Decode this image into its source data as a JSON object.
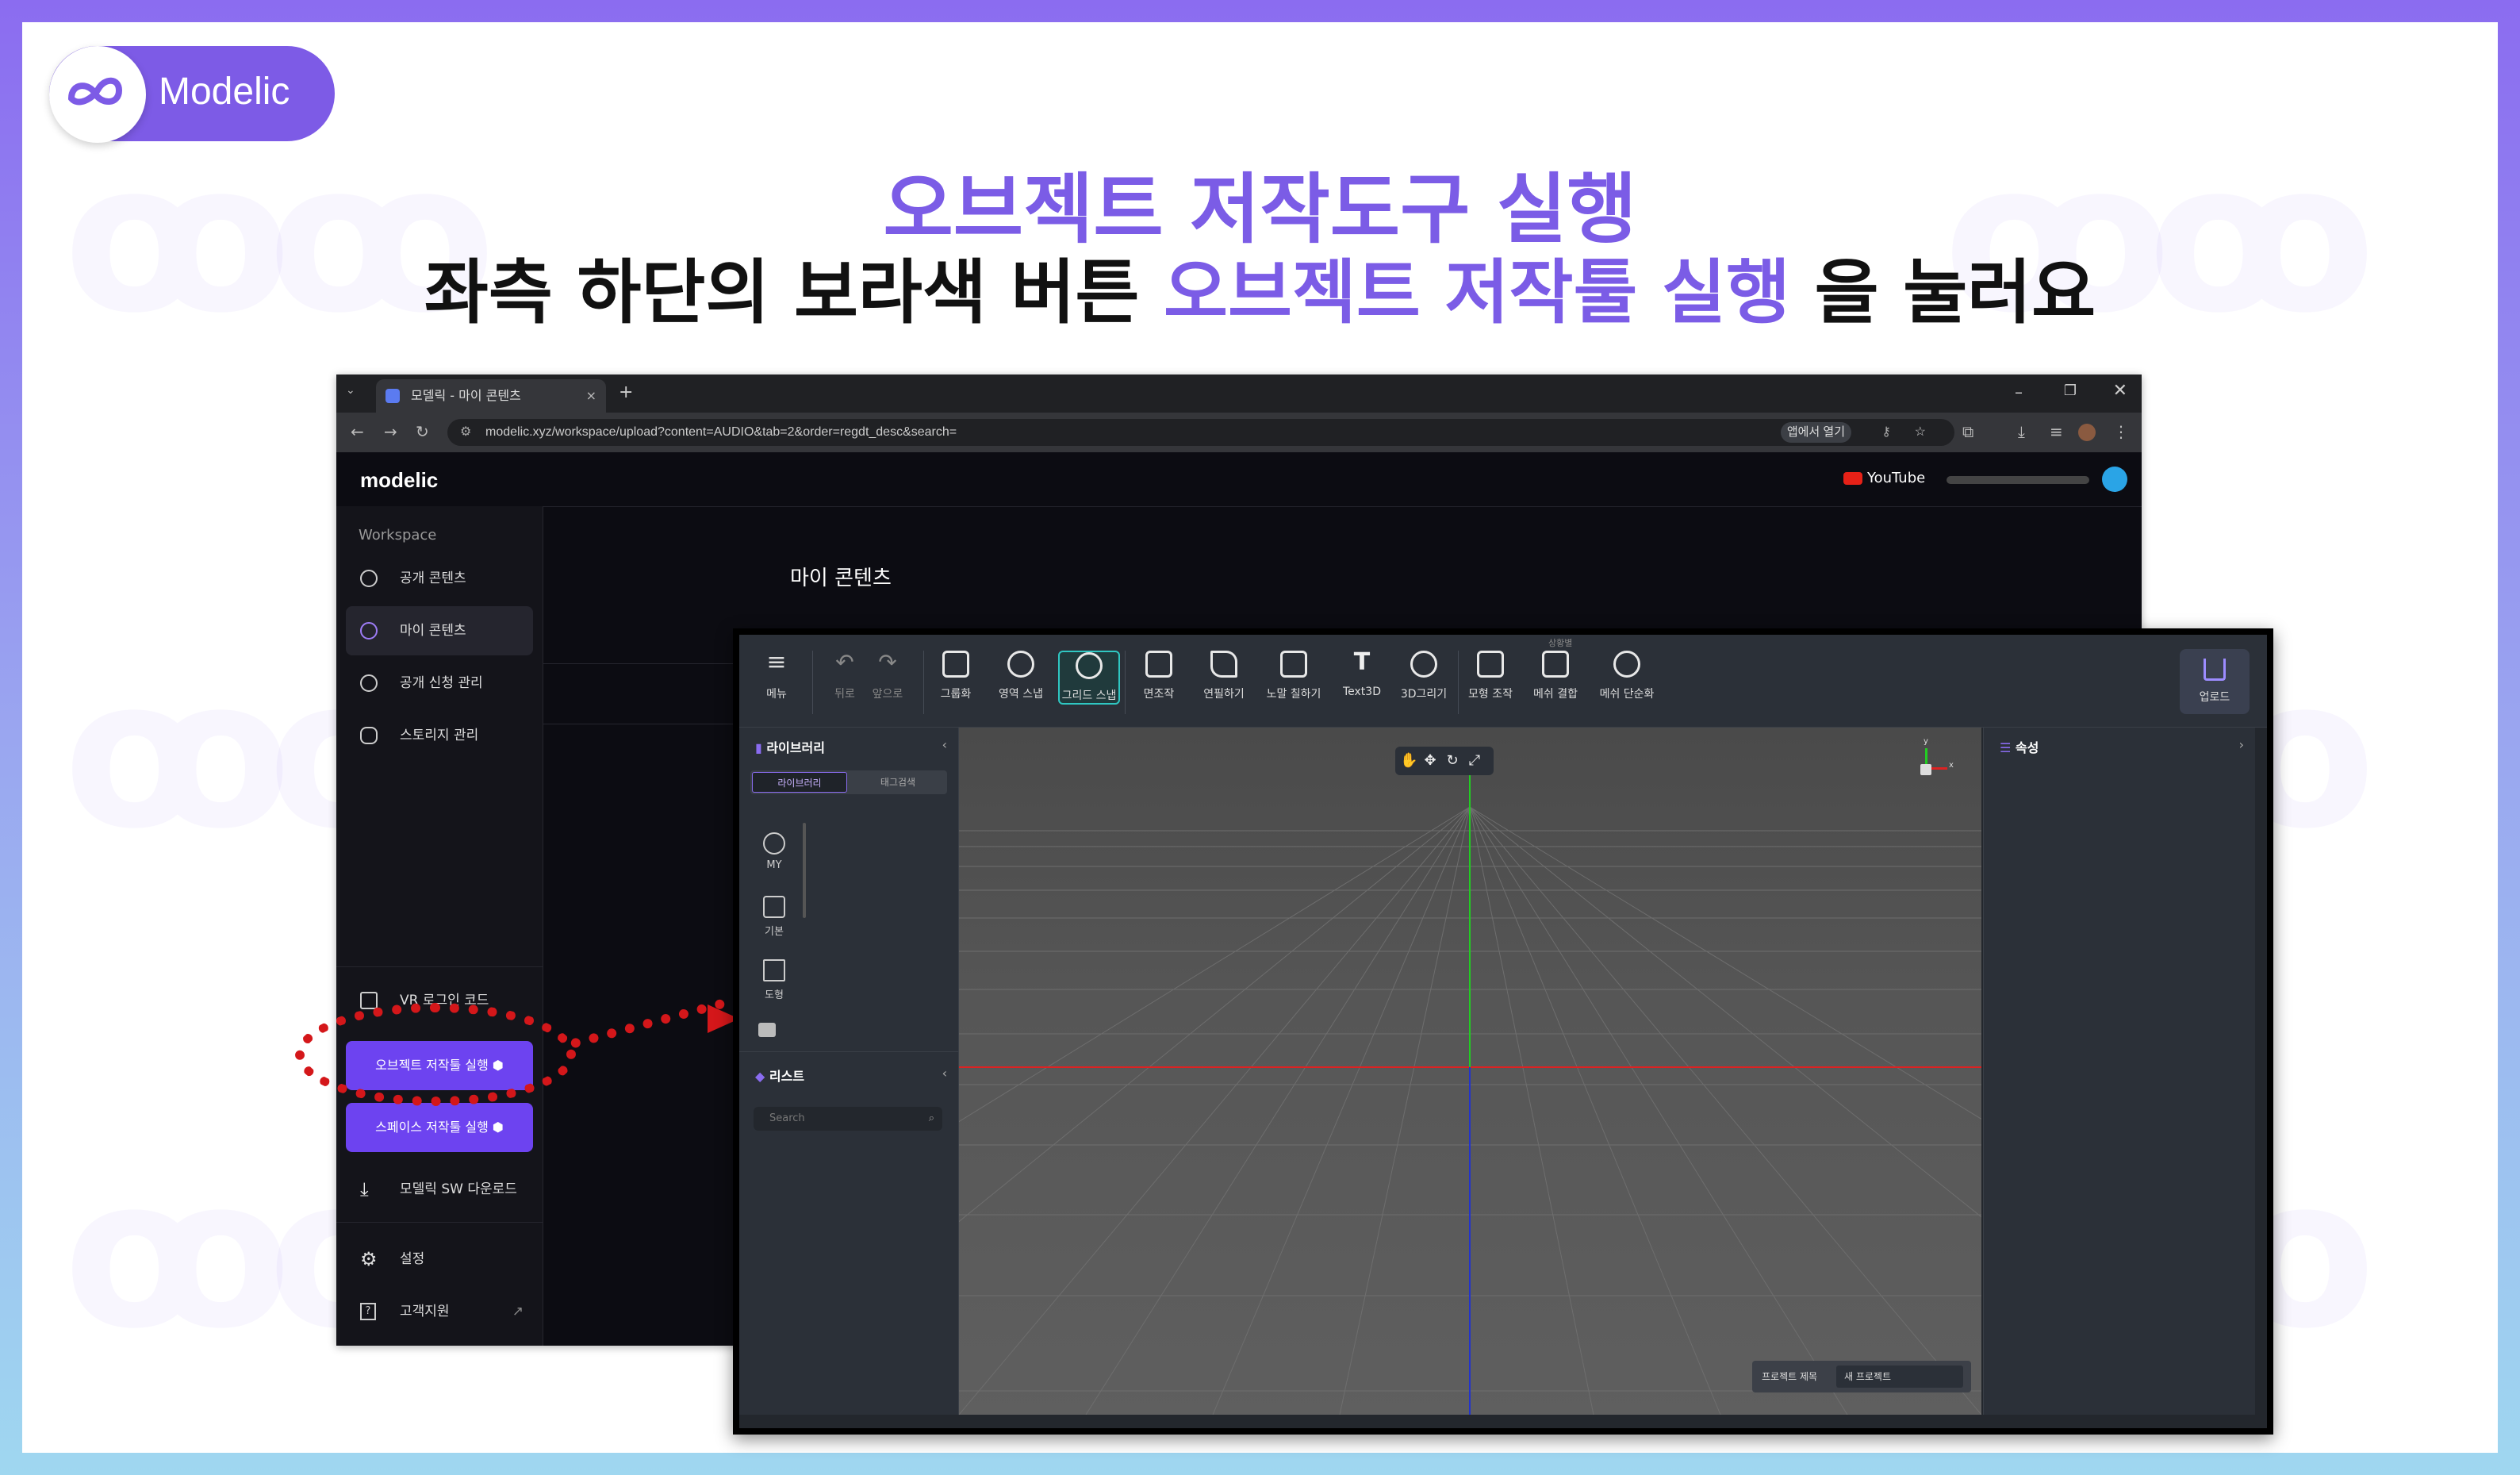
{
  "brand": {
    "name": "Modelic"
  },
  "headline": {
    "line1": "오브젝트 저작도구 실행",
    "line2_pre": "좌측 하단의 보라색 버튼 ",
    "line2_highlight": "오브젝트 저작툴 실행",
    "line2_post": " 을 눌러요"
  },
  "browser": {
    "tab_title": "모델릭 - 마이 콘텐츠",
    "tab_close": "×",
    "new_tab": "+",
    "url": "modelic.xyz/workspace/upload?content=AUDIO&tab=2&order=regdt_desc&search=",
    "open_in_app": "앱에서 열기"
  },
  "app": {
    "logo": "modelic",
    "youtube": "YouTube",
    "sidebar_heading": "Workspace",
    "sidebar_items": [
      {
        "label": "공개 콘텐츠",
        "icon": "globe-icon"
      },
      {
        "label": "마이 콘텐츠",
        "icon": "user-icon"
      },
      {
        "label": "공개 신청 관리",
        "icon": "globe-icon"
      },
      {
        "label": "스토리지 관리",
        "icon": "cloud-icon"
      }
    ],
    "vr_login": "VR 로그인 코드",
    "btn_object_tool": "오브젝트 저작툴 실행",
    "btn_space_tool": "스페이스 저작툴 실행",
    "download": "모델릭 SW 다운로드",
    "settings": "설정",
    "support": "고객지원",
    "main_title": "마이 콘텐츠"
  },
  "editor": {
    "tools": [
      {
        "label": "메뉴",
        "icon": "menu-icon"
      },
      {
        "label": "뒤로",
        "icon": "undo-icon"
      },
      {
        "label": "앞으로",
        "icon": "redo-icon"
      },
      {
        "label": "그룹화",
        "icon": "group-icon"
      },
      {
        "label": "영역 스냅",
        "icon": "area-snap-icon"
      },
      {
        "label": "그리드 스냅",
        "icon": "grid-snap-icon"
      },
      {
        "label": "면조작",
        "icon": "face-icon"
      },
      {
        "label": "연필하기",
        "icon": "pencil-icon"
      },
      {
        "label": "노말 칠하기",
        "icon": "normal-paint-icon"
      },
      {
        "label": "Text3D",
        "icon": "text3d-icon"
      },
      {
        "label": "3D그리기",
        "icon": "draw3d-icon"
      },
      {
        "label": "모형 조작",
        "icon": "shape-edit-icon"
      },
      {
        "label": "메쉬 결합",
        "icon": "mesh-merge-icon"
      },
      {
        "label": "메쉬 단순화",
        "icon": "mesh-simplify-icon"
      }
    ],
    "mesh_merge_tag": "상황별",
    "upload": "업로드",
    "library_title": "라이브러리",
    "library_tab": "라이브러리",
    "tag_search_tab": "태그검색",
    "categories": [
      "MY",
      "기본",
      "도형"
    ],
    "list_title": "리스트",
    "search_placeholder": "Search",
    "properties_title": "속성",
    "project_title_label": "프로젝트 제목",
    "project_title_value": "새 프로젝트",
    "axis_labels": {
      "y": "y",
      "x": "x"
    }
  }
}
